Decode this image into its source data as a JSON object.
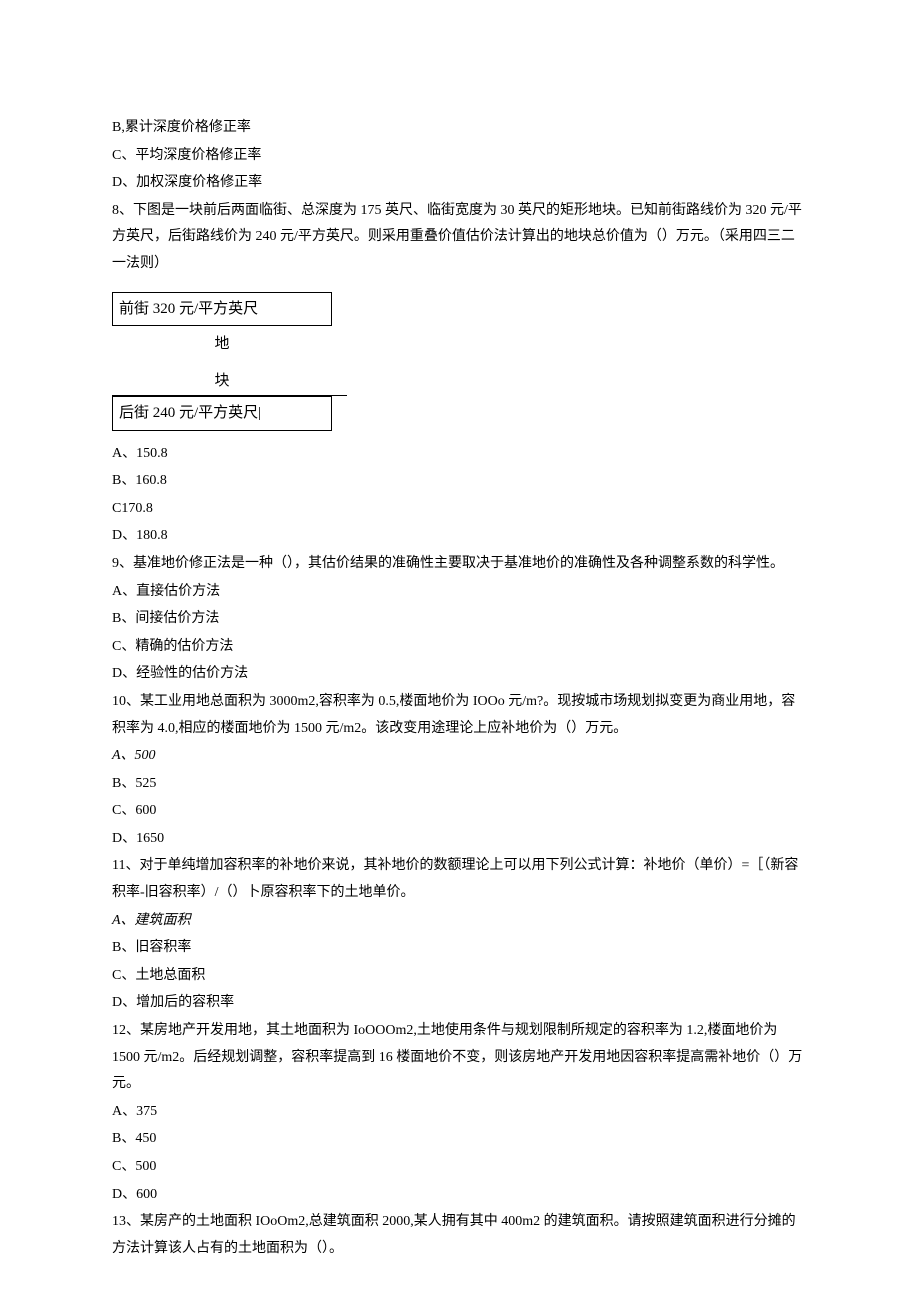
{
  "options_pre": [
    "B,累计深度价格修正率",
    "C、平均深度价格修正率",
    "D、加权深度价格修正率"
  ],
  "q8": {
    "text": "8、下图是一块前后两面临街、总深度为 175 英尺、临街宽度为 30 英尺的矩形地块。已知前街路线价为 320 元/平方英尺，后街路线价为 240 元/平方英尺。则采用重叠价值估价法计算出的地块总价值为（）万元。（采用四三二一法则）",
    "diagram": {
      "front": "前街 320 元/平方英尺",
      "mid1": "地",
      "mid2": "块",
      "back": "后街 240 元/平方英尺|"
    },
    "opts": [
      "A、150.8",
      "B、160.8",
      "C170.8",
      "D、180.8"
    ]
  },
  "q9": {
    "text": "9、基准地价修正法是一种（），其估价结果的准确性主要取决于基准地价的准确性及各种调整系数的科学性。",
    "opts": [
      "A、直接估价方法",
      "B、间接估价方法",
      "C、精确的估价方法",
      "D、经验性的估价方法"
    ]
  },
  "q10": {
    "text": "10、某工业用地总面积为 3000m2,容积率为 0.5,楼面地价为 IOOo 元/m?。现按城市场规划拟变更为商业用地，容积率为 4.0,相应的楼面地价为 1500 元/m2。该改变用途理论上应补地价为（）万元。",
    "opts": [
      "A、500",
      "B、525",
      "C、600",
      "D、1650"
    ]
  },
  "q11": {
    "text": "11、对于单纯增加容积率的补地价来说，其补地价的数额理论上可以用下列公式计算：补地价（单价）=［（新容积率-旧容积率）/（）卜原容积率下的土地单价。",
    "opts": [
      "A、建筑面积",
      "B、旧容积率",
      "C、土地总面积",
      "D、增加后的容积率"
    ]
  },
  "q12": {
    "text": "12、某房地产开发用地，其土地面积为 IoOOOm2,土地使用条件与规划限制所规定的容积率为 1.2,楼面地价为 1500 元/m2。后经规划调整，容积率提高到 16 楼面地价不变，则该房地产开发用地因容积率提高需补地价（）万元。",
    "opts": [
      "A、375",
      "B、450",
      "C、500",
      "D、600"
    ]
  },
  "q13": {
    "text": "13、某房产的土地面积 IOoOm2,总建筑面积 2000,某人拥有其中 400m2 的建筑面积。请按照建筑面积进行分摊的方法计算该人占有的土地面积为（）。"
  }
}
